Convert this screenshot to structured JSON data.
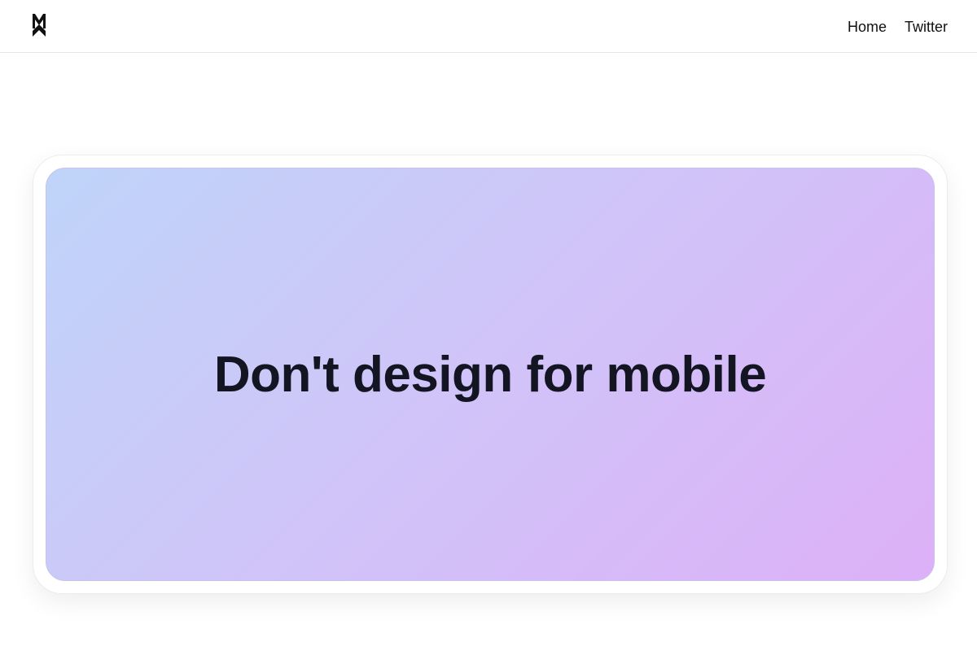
{
  "brand": {
    "logo_icon": "m-monogram-logo-icon"
  },
  "nav": {
    "links": [
      {
        "label": "Home"
      },
      {
        "label": "Twitter"
      }
    ]
  },
  "hero": {
    "headline": "Don't design for mobile"
  },
  "colors": {
    "text": "#131522",
    "gradient_start": "#bfd4f9",
    "gradient_mid": "#cfc5f8",
    "gradient_end": "#ddb0f7",
    "background": "#ffffff"
  }
}
